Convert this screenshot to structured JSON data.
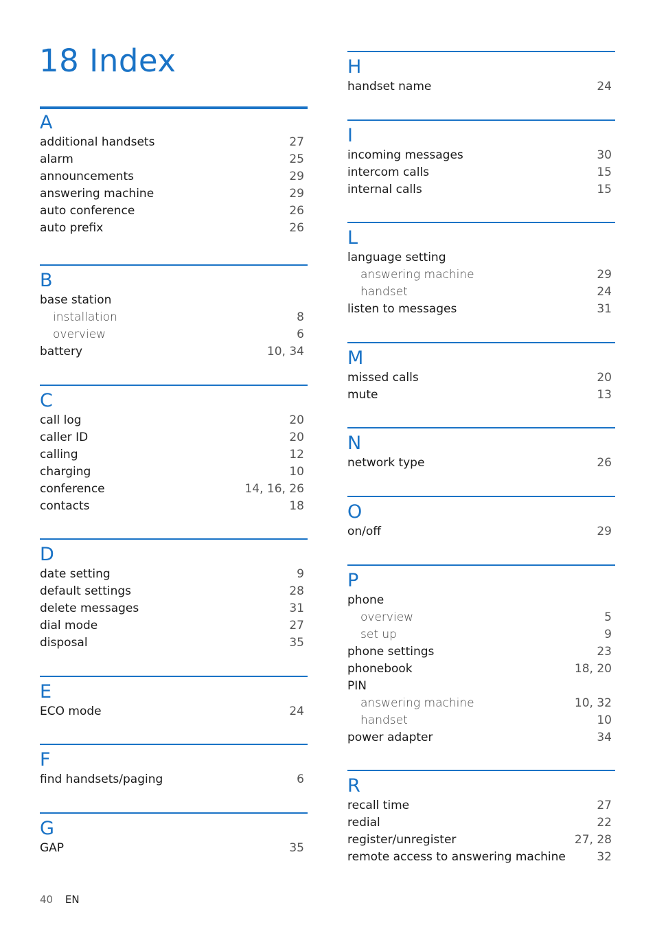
{
  "page": {
    "title": "18 Index",
    "footer": {
      "page_number": "40",
      "language": "EN"
    },
    "accent_color": "#1a73c6"
  },
  "left_column": [
    {
      "letter": "A",
      "entries": [
        {
          "term": "additional handsets",
          "pages": "27",
          "sub": false
        },
        {
          "term": "alarm",
          "pages": "25",
          "sub": false
        },
        {
          "term": "announcements",
          "pages": "29",
          "sub": false
        },
        {
          "term": "answering machine",
          "pages": "29",
          "sub": false
        },
        {
          "term": "auto conference",
          "pages": "26",
          "sub": false
        },
        {
          "term": "auto prefix",
          "pages": "26",
          "sub": false
        }
      ]
    },
    {
      "letter": "B",
      "entries": [
        {
          "term": "base station",
          "pages": "",
          "sub": false
        },
        {
          "term": "installation",
          "pages": "8",
          "sub": true
        },
        {
          "term": "overview",
          "pages": "6",
          "sub": true
        },
        {
          "term": "battery",
          "pages": "10, 34",
          "sub": false
        }
      ]
    },
    {
      "letter": "C",
      "entries": [
        {
          "term": "call log",
          "pages": "20",
          "sub": false
        },
        {
          "term": "caller ID",
          "pages": "20",
          "sub": false
        },
        {
          "term": "calling",
          "pages": "12",
          "sub": false
        },
        {
          "term": "charging",
          "pages": "10",
          "sub": false
        },
        {
          "term": "conference",
          "pages": "14, 16, 26",
          "sub": false
        },
        {
          "term": "contacts",
          "pages": "18",
          "sub": false
        }
      ]
    },
    {
      "letter": "D",
      "entries": [
        {
          "term": "date setting",
          "pages": "9",
          "sub": false
        },
        {
          "term": "default settings",
          "pages": "28",
          "sub": false
        },
        {
          "term": "delete messages",
          "pages": "31",
          "sub": false
        },
        {
          "term": "dial mode",
          "pages": "27",
          "sub": false
        },
        {
          "term": "disposal",
          "pages": "35",
          "sub": false
        }
      ]
    },
    {
      "letter": "E",
      "entries": [
        {
          "term": "ECO mode",
          "pages": "24",
          "sub": false
        }
      ]
    },
    {
      "letter": "F",
      "entries": [
        {
          "term": "find handsets/paging",
          "pages": "6",
          "sub": false
        }
      ]
    },
    {
      "letter": "G",
      "entries": [
        {
          "term": "GAP",
          "pages": "35",
          "sub": false
        }
      ]
    }
  ],
  "right_column": [
    {
      "letter": "H",
      "entries": [
        {
          "term": "handset name",
          "pages": "24",
          "sub": false
        }
      ]
    },
    {
      "letter": "I",
      "entries": [
        {
          "term": "incoming messages",
          "pages": "30",
          "sub": false
        },
        {
          "term": "intercom calls",
          "pages": "15",
          "sub": false
        },
        {
          "term": "internal calls",
          "pages": "15",
          "sub": false
        }
      ]
    },
    {
      "letter": "L",
      "entries": [
        {
          "term": "language setting",
          "pages": "",
          "sub": false
        },
        {
          "term": "answering machine",
          "pages": "29",
          "sub": true
        },
        {
          "term": "handset",
          "pages": "24",
          "sub": true
        },
        {
          "term": "listen to messages",
          "pages": "31",
          "sub": false
        }
      ]
    },
    {
      "letter": "M",
      "entries": [
        {
          "term": "missed calls",
          "pages": "20",
          "sub": false
        },
        {
          "term": "mute",
          "pages": "13",
          "sub": false
        }
      ]
    },
    {
      "letter": "N",
      "entries": [
        {
          "term": "network type",
          "pages": "26",
          "sub": false
        }
      ]
    },
    {
      "letter": "O",
      "entries": [
        {
          "term": "on/off",
          "pages": "29",
          "sub": false
        }
      ]
    },
    {
      "letter": "P",
      "entries": [
        {
          "term": "phone",
          "pages": "",
          "sub": false
        },
        {
          "term": "overview",
          "pages": "5",
          "sub": true
        },
        {
          "term": "set up",
          "pages": "9",
          "sub": true
        },
        {
          "term": "phone settings",
          "pages": "23",
          "sub": false
        },
        {
          "term": "phonebook",
          "pages": "18, 20",
          "sub": false
        },
        {
          "term": "PIN",
          "pages": "",
          "sub": false
        },
        {
          "term": "answering machine",
          "pages": "10, 32",
          "sub": true
        },
        {
          "term": "handset",
          "pages": "10",
          "sub": true
        },
        {
          "term": "power adapter",
          "pages": "34",
          "sub": false
        }
      ]
    },
    {
      "letter": "R",
      "entries": [
        {
          "term": "recall time",
          "pages": "27",
          "sub": false
        },
        {
          "term": "redial",
          "pages": "22",
          "sub": false
        },
        {
          "term": "register/unregister",
          "pages": "27, 28",
          "sub": false
        },
        {
          "term": "remote access to answering machine",
          "pages": "32",
          "sub": false
        }
      ]
    }
  ]
}
